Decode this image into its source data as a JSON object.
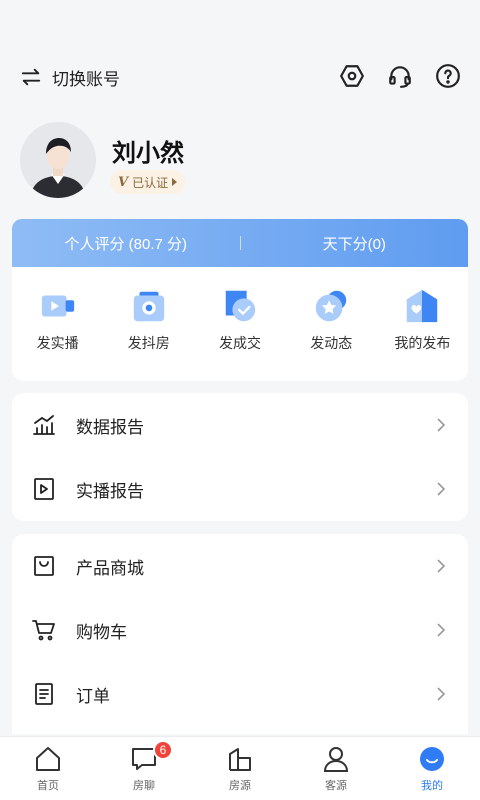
{
  "header": {
    "switch_account_label": "切换账号"
  },
  "profile": {
    "name": "刘小然",
    "verify_label": "已认证",
    "verify_letter": "V"
  },
  "score_bar": {
    "personal_score": "个人评分 (80.7 分)",
    "world_score": "天下分(0)"
  },
  "quick_actions": [
    {
      "label": "发实播",
      "icon": "live-video-icon"
    },
    {
      "label": "发抖房",
      "icon": "camera-icon"
    },
    {
      "label": "发成交",
      "icon": "deal-icon"
    },
    {
      "label": "发动态",
      "icon": "star-bubble-icon"
    },
    {
      "label": "我的发布",
      "icon": "my-post-icon"
    }
  ],
  "menu_groups": [
    [
      {
        "label": "数据报告",
        "icon": "chart-icon"
      },
      {
        "label": "实播报告",
        "icon": "play-doc-icon"
      }
    ],
    [
      {
        "label": "产品商城",
        "icon": "shopping-bag-icon"
      },
      {
        "label": "购物车",
        "icon": "cart-icon"
      },
      {
        "label": "订单",
        "icon": "order-icon"
      }
    ]
  ],
  "tabs": [
    {
      "label": "首页",
      "icon": "home-icon",
      "active": false
    },
    {
      "label": "房聊",
      "icon": "chat-icon",
      "active": false,
      "badge": "6"
    },
    {
      "label": "房源",
      "icon": "building-icon",
      "active": false
    },
    {
      "label": "客源",
      "icon": "person-icon",
      "active": false
    },
    {
      "label": "我的",
      "icon": "smile-icon",
      "active": true
    }
  ],
  "colors": {
    "accent": "#2f7cf6",
    "badge": "#f0433a",
    "score_bar_start": "#8fbcf5",
    "score_bar_end": "#5f9cf0"
  }
}
